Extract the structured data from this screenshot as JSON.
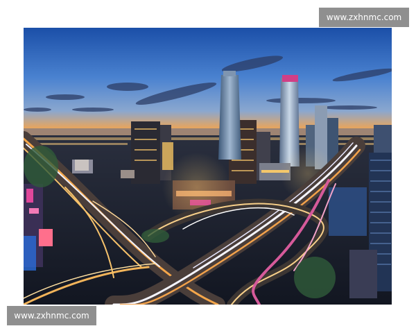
{
  "watermarks": {
    "top_right": "www.zxhnmc.com",
    "bottom_left": "www.zxhnmc.com"
  },
  "photo": {
    "subject": "city-skyline-at-dusk-with-light-trails"
  },
  "colors": {
    "sky_top": "#1a5fb4",
    "sky_mid": "#5c8fd6",
    "horizon": "#f2a24b",
    "watermark_bg": "#8f8f8f",
    "city_glow": "#f4c76a"
  }
}
